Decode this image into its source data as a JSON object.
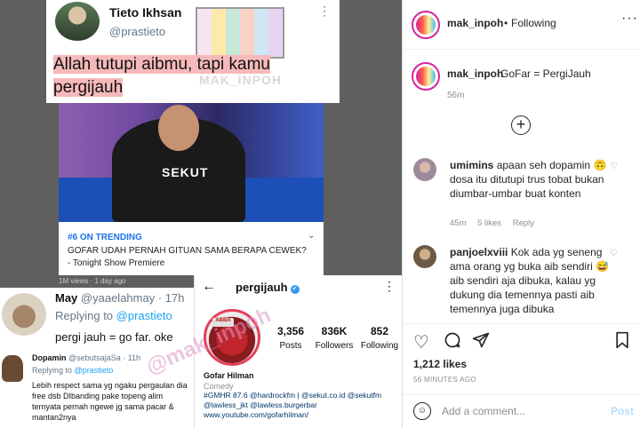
{
  "collage": {
    "tweet": {
      "name": "Tieto Ikhsan",
      "handle": "@prastieto",
      "more_icon": "more-vert-icon",
      "text": "Allah tutupi aibmu, tapi kamu pergijauh",
      "watermark": "MAK_INPOH",
      "highlight_color": "#f6b9b9"
    },
    "show_card": {
      "shirt_text": "SEKUT",
      "tag": "#6 ON TRENDING",
      "title": "GOFAR UDAH PERNAH GITUAN SAMA BERAPA CEWEK? - Tonight Show Premiere",
      "meta": "1M views · 1 day ago"
    },
    "reply_may": {
      "name": "May",
      "handle_time": "@yaaelahmay · 17h",
      "replying_prefix": "Replying to",
      "replying_to": "@prastieto",
      "text": "pergi jauh = go far. oke"
    },
    "reply_dopamin": {
      "name": "Dopamin",
      "handle_time": "@sebutsajaSa · 11h",
      "replying_prefix": "Replying to",
      "replying_to": "@prastieto",
      "text": "Lebih respect sama yg ngaku pergaulan dia free dsb DIbanding pake topeng alim ternyata pernah ngewe jg sama pacar & mantan2nya"
    },
    "profile": {
      "username": "pergijauh",
      "verified": "✓",
      "posts_num": "3,356",
      "posts_label": "Posts",
      "followers_num": "836K",
      "followers_label": "Followers",
      "following_num": "852",
      "following_label": "Following",
      "name": "Gofar Hilman",
      "category": "Comedy",
      "bio_lines": [
        "#GMHR 87.6 @hardrockfm | @sekut.co.id @sekutfm",
        "@lawless_jkt @lawless.burgerbar",
        "www.youtube.com/gofarhilman/"
      ],
      "logo_text": "ABBA"
    },
    "watermark2": "@mak_inpoh"
  },
  "ig": {
    "header": {
      "username": "mak_inpoh",
      "separator": "•",
      "follow_label": "Following",
      "more_icon": "more-horiz-icon"
    },
    "caption": {
      "username": "mak_inpoh",
      "text": "GoFar = PergiJauh",
      "time": "56m"
    },
    "load_more_icon": "plus-circle-icon",
    "comments": [
      {
        "username": "umimins",
        "text": "apaan seh dopamin 🙃 dosa itu ditutupi trus tobat bukan diumbar-umbar buat konten",
        "time": "45m",
        "likes": "5 likes",
        "reply": "Reply"
      },
      {
        "username": "panjoelxviii",
        "text": "Kok ada yg seneng ama orang yg buka aib sendiri 😅 aib sendiri aja dibuka, kalau yg dukung dia temennya pasti aib temennya juga dibuka"
      }
    ],
    "likes": "1,212 likes",
    "timestamp": "56 MINUTES AGO",
    "comment_placeholder": "Add a comment...",
    "post_label": "Post",
    "icons": {
      "like": "heart-icon",
      "comment": "comment-icon",
      "share": "send-icon",
      "save": "bookmark-icon"
    },
    "colors": {
      "link_blue": "#00376b",
      "post_disabled": "#b2dffc"
    }
  }
}
